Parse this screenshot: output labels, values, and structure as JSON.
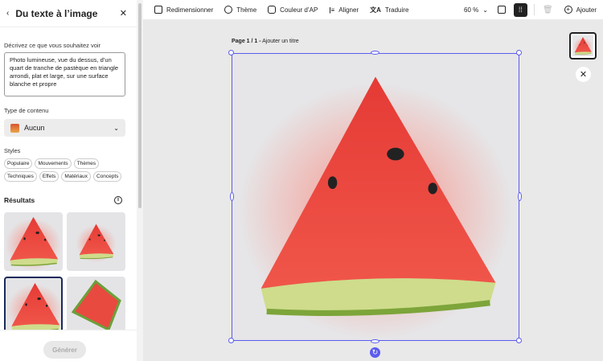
{
  "panel": {
    "back_icon": "chevron-left-icon",
    "title": "Du texte à l’image",
    "close_icon": "close-icon",
    "prompt_label": "Décrivez ce que vous souhaitez voir",
    "prompt_value": "Photo lumineuse, vue du dessus, d’un quart de tranche de pastèque en triangle arrondi, plat et large, sur une surface blanche et propre",
    "content_type_label": "Type de contenu",
    "content_type_value": "Aucun",
    "styles_label": "Styles",
    "styles": [
      "Populaire",
      "Mouvements",
      "Thèmes",
      "Techniques",
      "Effets",
      "Matériaux",
      "Concepts"
    ],
    "results_label": "Résultats",
    "generate_label": "Générer"
  },
  "toolbar": {
    "resize": "Redimensionner",
    "theme": "Thème",
    "color": "Couleur d’AP",
    "align": "Aligner",
    "translate": "Traduire",
    "zoom": "60 %",
    "add": "Ajouter"
  },
  "canvas": {
    "page_label": "Page 1 / 1 -",
    "page_title_placeholder": "Ajouter un titre"
  },
  "colors": {
    "accent": "#5b5bf0",
    "flesh": "#e8433c",
    "rind": "#c9d98a"
  }
}
